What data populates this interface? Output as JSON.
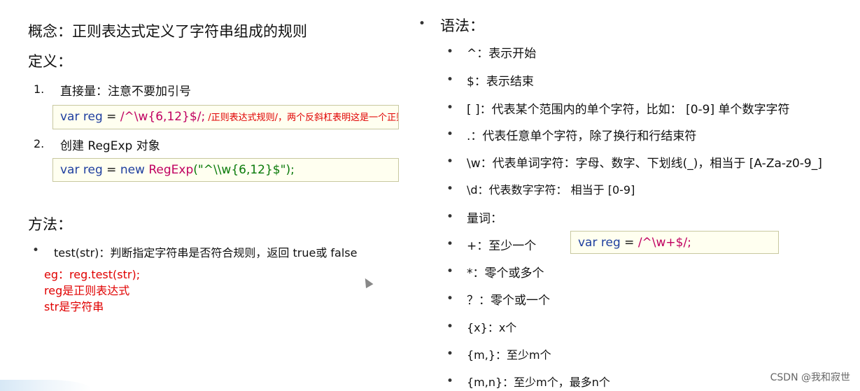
{
  "left": {
    "concept": "概念：正则表达式定义了字符串组成的规则",
    "definition_title": "定义：",
    "items": [
      {
        "num": "1.",
        "label": "直接量：注意不要加引号"
      },
      {
        "num": "2.",
        "label": "创建 RegExp 对象"
      }
    ],
    "code1": {
      "kw": "var reg",
      "eq": " = ",
      "regex": "/^\\w{6,12}$/;",
      "comment": " /正则表达式规则/，两个反斜杠表明这是一个正则表达式"
    },
    "code2": {
      "kw": "var reg",
      "eq": " = ",
      "new": "new ",
      "ctor": "RegExp",
      "arg": "(\"^\\\\w{6,12}$\");"
    },
    "methods_title": "方法：",
    "method_bullet": "•",
    "method_text": "test(str)：判断指定字符串是否符合规则，返回 true或 false",
    "examples": [
      "eg：reg.test(str);",
      "reg是正则表达式",
      "str是字符串"
    ]
  },
  "right": {
    "syntax_title": "语法：",
    "bullet": "•",
    "items": [
      "^：表示开始",
      "$：表示结束",
      "[ ]：代表某个范围内的单个字符，比如： [0-9] 单个数字字符",
      ".：代表任意单个字符，除了换行和行结束符",
      "\\w：代表单词字符：字母、数字、下划线(_)，相当于 [A-Za-z0-9_]",
      "\\d：代表数字字符： 相当于 [0-9]",
      "量词：",
      "+：至少一个",
      "*：零个或多个",
      "？：零个或一个",
      "{x}：x个",
      "{m,}：至少m个",
      "{m,n}：至少m个，最多n个"
    ],
    "code3": {
      "kw": "var reg",
      "eq": " = ",
      "regex": "/^\\w+$/;"
    }
  },
  "watermark": "CSDN @我和寂世"
}
